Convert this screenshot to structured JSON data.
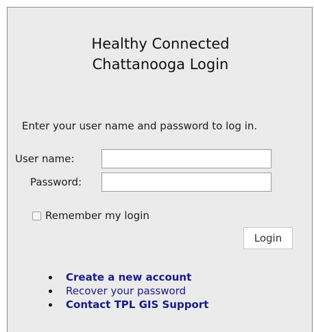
{
  "login_panel": {
    "title_line1": "Healthy Connected",
    "title_line2": "Chattanooga Login",
    "instructions": "Enter your user name and password to log in.",
    "username_label": "User name:",
    "username_value": "",
    "password_label": "Password:",
    "password_value": "",
    "remember_label": "Remember my login",
    "remember_checked": false,
    "login_button": "Login"
  },
  "links": {
    "create_account": "Create a new account",
    "recover_password": "Recover your password",
    "contact_support": "Contact TPL GIS Support"
  },
  "colors": {
    "panel_bg": "#ebebeb",
    "link": "#1a1a8c"
  }
}
